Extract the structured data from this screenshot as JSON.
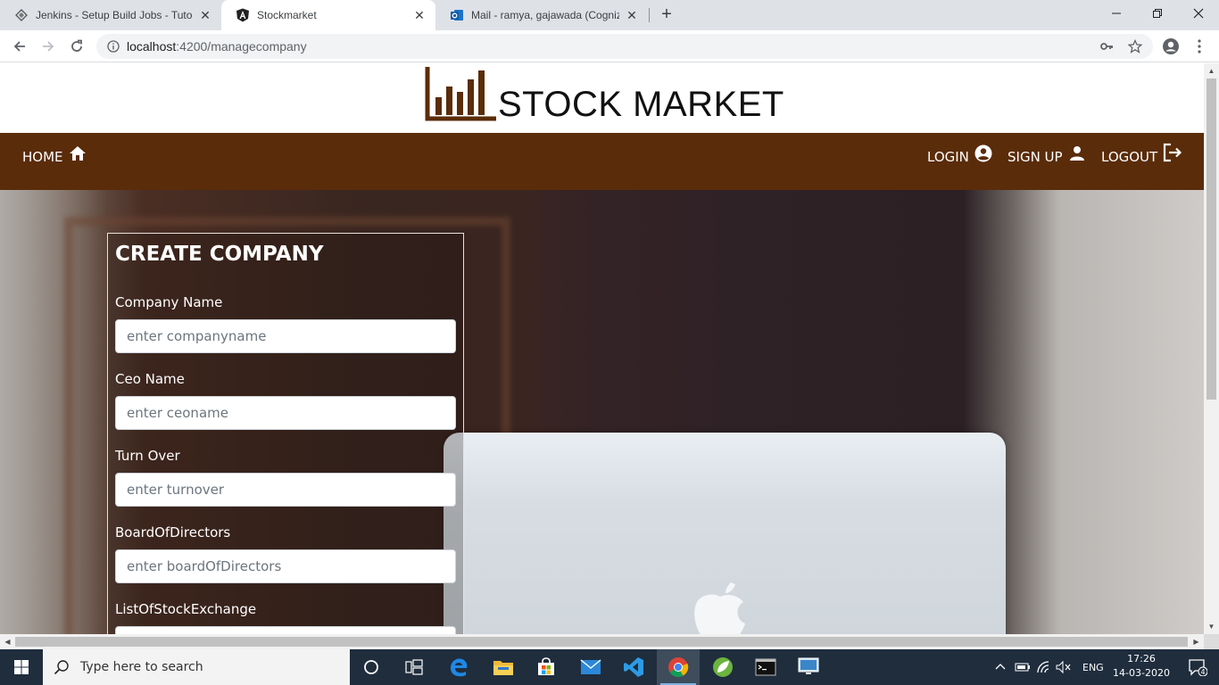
{
  "browser": {
    "tabs": [
      {
        "title": "Jenkins - Setup Build Jobs - Tuto",
        "icon": "jenkins-icon"
      },
      {
        "title": "Stockmarket",
        "icon": "angular-icon",
        "active": true
      },
      {
        "title": "Mail - ramya, gajawada (Cogniza",
        "icon": "outlook-icon"
      }
    ],
    "url_host": "localhost",
    "url_rest": ":4200/managecompany"
  },
  "site": {
    "logo_text": "STOCK MARKET",
    "nav": {
      "home": "HOME",
      "login": "LOGIN",
      "signup": "SIGN UP",
      "logout": "LOGOUT"
    }
  },
  "form": {
    "title": "CREATE COMPANY",
    "fields": [
      {
        "label": "Company Name",
        "placeholder": "enter companyname"
      },
      {
        "label": "Ceo Name",
        "placeholder": "enter ceoname"
      },
      {
        "label": "Turn Over",
        "placeholder": "enter turnover"
      },
      {
        "label": "BoardOfDirectors",
        "placeholder": "enter boardOfDirectors"
      },
      {
        "label": "ListOfStockExchange",
        "placeholder": ""
      }
    ]
  },
  "taskbar": {
    "search_placeholder": "Type here to search",
    "language": "ENG",
    "time": "17:26",
    "date": "14-03-2020",
    "notifications": "4"
  },
  "colors": {
    "navbar": "#5a2c0a",
    "accent_logo": "#5a2c0a"
  }
}
